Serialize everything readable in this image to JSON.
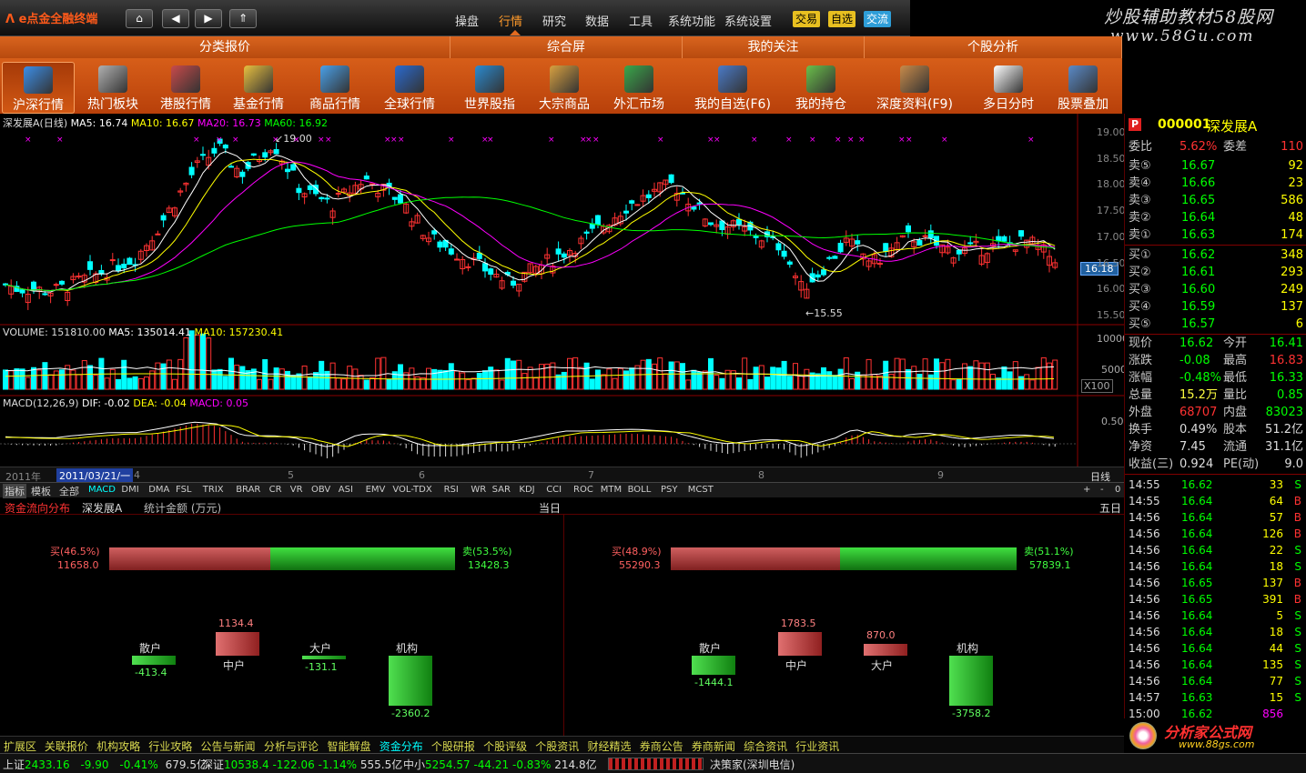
{
  "app": {
    "logo": "e点金全融终端",
    "menus": [
      "操盘",
      "行情",
      "研究",
      "数据",
      "工具",
      "系统功能",
      "系统设置"
    ],
    "active_menu": "行情",
    "pills": [
      {
        "label": "交易",
        "bg": "#e8c020"
      },
      {
        "label": "自选",
        "bg": "#e8c020"
      },
      {
        "label": "交流",
        "bg": "#2e9ed8"
      }
    ],
    "nav_buttons": [
      "home-icon",
      "arrow-left-icon",
      "arrow-right-icon",
      "double-chevron-up-icon"
    ]
  },
  "watermark": {
    "line1": "炒股辅助教材58股网",
    "line2": "www.58Gu.com"
  },
  "sections": [
    "分类报价",
    "综合屏",
    "我的关注",
    "个股分析"
  ],
  "toolbar": [
    {
      "label": "沪深行情",
      "icon": "market-icon",
      "color": "#3c8ee8"
    },
    {
      "label": "热门板块",
      "icon": "sector-icon",
      "color": "#b0b0b0"
    },
    {
      "label": "港股行情",
      "icon": "hk-icon",
      "color": "#c84a4a"
    },
    {
      "label": "基金行情",
      "icon": "fund-icon",
      "color": "#e8c040"
    },
    {
      "label": "商品行情",
      "icon": "commodity-icon",
      "color": "#4aa0e8"
    },
    {
      "label": "全球行情",
      "icon": "globe-icon",
      "color": "#2a6ad0"
    },
    {
      "label": "世界股指",
      "icon": "world-index-icon",
      "color": "#2a8ad0"
    },
    {
      "label": "大宗商品",
      "icon": "bulk-icon",
      "color": "#d8a040"
    },
    {
      "label": "外汇市场",
      "icon": "forex-icon",
      "color": "#3aa84a"
    },
    {
      "label": "我的自选(F6)",
      "icon": "user-icon",
      "color": "#4a7ac8"
    },
    {
      "label": "我的持仓",
      "icon": "clock-icon",
      "color": "#6ac04a"
    },
    {
      "label": "深度资料(F9)",
      "icon": "docs-icon",
      "color": "#c88a4a"
    },
    {
      "label": "多日分时",
      "icon": "calendar-icon",
      "color": "#ffffff"
    },
    {
      "label": "股票叠加",
      "icon": "overlay-icon",
      "color": "#5a8ac8"
    }
  ],
  "chart": {
    "main_title": "深发展A(日线)",
    "ma5": "MA5: 16.74",
    "ma10": "MA10: 16.67",
    "ma20": "MA20: 16.73",
    "ma60": "MA60: 16.92",
    "price_ticks": [
      "19.00",
      "18.50",
      "18.00",
      "17.50",
      "17.00",
      "16.50",
      "16.00",
      "15.50"
    ],
    "current_price": "16.18",
    "high_mark": "19.00",
    "low_mark": "15.55",
    "vol_title": "VOLUME: 151810.00",
    "vol_ma5": "MA5: 135014.41",
    "vol_ma10": "MA10: 157230.41",
    "vol_ticks": [
      "10000",
      "5000"
    ],
    "vol_unit": "X100",
    "macd_title": "MACD(12,26,9)",
    "macd_dif": "DIF: -0.02",
    "macd_dea": "DEA: -0.04",
    "macd_val": "MACD: 0.05",
    "macd_tick": "0.50",
    "date_left": "2011年",
    "date_cursor": "2011/03/21/一",
    "months": [
      "4",
      "5",
      "6",
      "7",
      "8",
      "9"
    ],
    "period": "日线",
    "colors": {
      "up": "#ff3232",
      "down": "#00ffff",
      "ma5": "#ffffff",
      "ma10": "#ffff00",
      "ma20": "#ff00ff",
      "ma60": "#00ff00"
    }
  },
  "indicators": {
    "tabs": [
      "指标",
      "模板",
      "全部"
    ],
    "items": [
      "MACD",
      "DMI",
      "DMA",
      "FSL",
      "TRIX",
      "BRAR",
      "CR",
      "VR",
      "OBV",
      "ASI",
      "EMV",
      "VOL-TDX",
      "RSI",
      "WR",
      "SAR",
      "KDJ",
      "CCI",
      "ROC",
      "MTM",
      "BOLL",
      "PSY",
      "MCST"
    ],
    "active": "MACD",
    "controls": [
      "+",
      "-",
      "0"
    ]
  },
  "fundflow": {
    "title": "资金流向分布",
    "stock": "深发展A",
    "unit": "统计金额 (万元)",
    "left": {
      "period": "当日",
      "buy_label": "买(46.5%)",
      "buy_value": "11658.0",
      "sell_label": "卖(53.5%)",
      "sell_value": "13428.3",
      "buy_pct": 46.5,
      "cats": [
        {
          "name": "散户",
          "value": "-413.4",
          "num": -413.4
        },
        {
          "name": "中户",
          "value": "1134.4",
          "num": 1134.4
        },
        {
          "name": "大户",
          "value": "-131.1",
          "num": -131.1
        },
        {
          "name": "机构",
          "value": "-2360.2",
          "num": -2360.2
        }
      ]
    },
    "right": {
      "period": "五日",
      "buy_label": "买(48.9%)",
      "buy_value": "55290.3",
      "sell_label": "卖(51.1%)",
      "sell_value": "57839.1",
      "buy_pct": 48.9,
      "cats": [
        {
          "name": "散户",
          "value": "-1444.1",
          "num": -1444.1
        },
        {
          "name": "中户",
          "value": "1783.5",
          "num": 1783.5
        },
        {
          "name": "大户",
          "value": "870.0",
          "num": 870.0
        },
        {
          "name": "机构",
          "value": "-3758.2",
          "num": -3758.2
        }
      ]
    }
  },
  "bottom_tabs": [
    "扩展区",
    "关联报价",
    "机构攻略",
    "行业攻略",
    "公告与新闻",
    "分析与评论",
    "智能解盘",
    "资金分布",
    "个股研报",
    "个股评级",
    "个股资讯",
    "财经精选",
    "券商公告",
    "券商新闻",
    "综合资讯",
    "行业资讯"
  ],
  "active_bottom_tab": "资金分布",
  "status": {
    "sh_label": "上证",
    "sh_val": "2433.16",
    "sh_chg": "-9.90",
    "sh_pct": "-0.41%",
    "sh_amt": "679.5亿",
    "sz_label": "深证",
    "sz_val": "10538.4",
    "sz_chg": "-122.06",
    "sz_pct": "-1.14%",
    "sz_amt": "555.5亿",
    "zx_label": "中小",
    "zx_val": "5254.57",
    "zx_chg": "-44.21",
    "zx_pct": "-0.83%",
    "zx_amt": "214.8亿",
    "broker": "决策家(深圳电信)"
  },
  "quote": {
    "code": "000001",
    "name": "深发展A",
    "wb_label": "委比",
    "wb_val": "5.62%",
    "wc_label": "委差",
    "wc_val": "110",
    "sells": [
      {
        "label": "卖⑤",
        "price": "16.67",
        "vol": "92"
      },
      {
        "label": "卖④",
        "price": "16.66",
        "vol": "23"
      },
      {
        "label": "卖③",
        "price": "16.65",
        "vol": "586"
      },
      {
        "label": "卖②",
        "price": "16.64",
        "vol": "48"
      },
      {
        "label": "卖①",
        "price": "16.63",
        "vol": "174"
      }
    ],
    "buys": [
      {
        "label": "买①",
        "price": "16.62",
        "vol": "348"
      },
      {
        "label": "买②",
        "price": "16.61",
        "vol": "293"
      },
      {
        "label": "买③",
        "price": "16.60",
        "vol": "249"
      },
      {
        "label": "买④",
        "price": "16.59",
        "vol": "137"
      },
      {
        "label": "买⑤",
        "price": "16.57",
        "vol": "6"
      }
    ],
    "stats": [
      {
        "l1": "现价",
        "v1": "16.62",
        "c1": "#0f0",
        "l2": "今开",
        "v2": "16.41",
        "c2": "#0f0"
      },
      {
        "l1": "涨跌",
        "v1": "-0.08",
        "c1": "#0f0",
        "l2": "最高",
        "v2": "16.83",
        "c2": "#ff3232"
      },
      {
        "l1": "涨幅",
        "v1": "-0.48%",
        "c1": "#0f0",
        "l2": "最低",
        "v2": "16.33",
        "c2": "#0f0"
      },
      {
        "l1": "总量",
        "v1": "15.2万",
        "c1": "#ffff40",
        "l2": "量比",
        "v2": "0.85",
        "c2": "#0f0"
      },
      {
        "l1": "外盘",
        "v1": "68707",
        "c1": "#ff3232",
        "l2": "内盘",
        "v2": "83023",
        "c2": "#0f0"
      },
      {
        "l1": "换手",
        "v1": "0.49%",
        "c1": "#ddd",
        "l2": "股本",
        "v2": "51.2亿",
        "c2": "#ddd"
      },
      {
        "l1": "净资",
        "v1": "7.45",
        "c1": "#ddd",
        "l2": "流通",
        "v2": "31.1亿",
        "c2": "#ddd"
      },
      {
        "l1": "收益(三)",
        "v1": "0.924",
        "c1": "#ddd",
        "l2": "PE(动)",
        "v2": "9.0",
        "c2": "#ddd"
      }
    ],
    "ticks": [
      {
        "t": "14:55",
        "p": "16.62",
        "v": "33",
        "s": "S"
      },
      {
        "t": "14:55",
        "p": "16.64",
        "v": "64",
        "s": "B"
      },
      {
        "t": "14:56",
        "p": "16.64",
        "v": "57",
        "s": "B"
      },
      {
        "t": "14:56",
        "p": "16.64",
        "v": "126",
        "s": "B"
      },
      {
        "t": "14:56",
        "p": "16.64",
        "v": "22",
        "s": "S"
      },
      {
        "t": "14:56",
        "p": "16.64",
        "v": "18",
        "s": "S"
      },
      {
        "t": "14:56",
        "p": "16.65",
        "v": "137",
        "s": "B"
      },
      {
        "t": "14:56",
        "p": "16.65",
        "v": "391",
        "s": "B"
      },
      {
        "t": "14:56",
        "p": "16.64",
        "v": "5",
        "s": "S"
      },
      {
        "t": "14:56",
        "p": "16.64",
        "v": "18",
        "s": "S"
      },
      {
        "t": "14:56",
        "p": "16.64",
        "v": "44",
        "s": "S"
      },
      {
        "t": "14:56",
        "p": "16.64",
        "v": "135",
        "s": "S"
      },
      {
        "t": "14:56",
        "p": "16.64",
        "v": "77",
        "s": "S"
      },
      {
        "t": "14:57",
        "p": "16.63",
        "v": "15",
        "s": "S"
      },
      {
        "t": "15:00",
        "p": "16.62",
        "v": "856",
        "s": ""
      }
    ]
  },
  "logo2": {
    "title": "分析家公式网",
    "url": "www.88gs.com"
  }
}
